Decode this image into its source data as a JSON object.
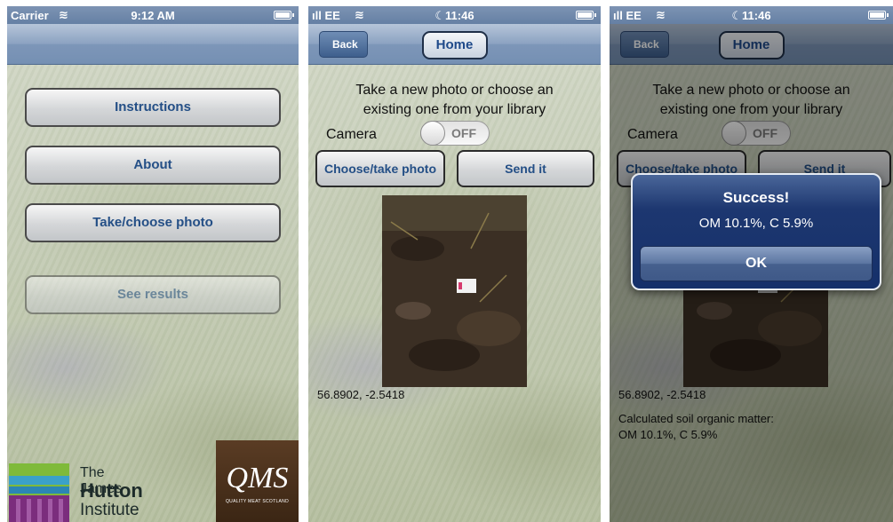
{
  "screen1": {
    "status": {
      "carrier": "Carrier",
      "time": "9:12 AM"
    },
    "menu": {
      "instructions": "Instructions",
      "about": "About",
      "take_choose_photo": "Take/choose photo",
      "see_results": "See results"
    },
    "logos": {
      "hutton_line1": "The James",
      "hutton_line2": "Hutton",
      "hutton_line3": "Institute",
      "qms": "QMS",
      "qms_sub": "QUALITY MEAT SCOTLAND"
    }
  },
  "screen2": {
    "status": {
      "carrier": "EE",
      "time": "11:46"
    },
    "nav": {
      "back": "Back",
      "home": "Home"
    },
    "prompt_line1": "Take a new photo or choose an",
    "prompt_line2": "existing one from your library",
    "camera_label": "Camera",
    "camera_toggle": "OFF",
    "choose_button": "Choose/take photo",
    "send_button": "Send it",
    "coords": "56.8902, -2.5418"
  },
  "screen3": {
    "status": {
      "carrier": "EE",
      "time": "11:46"
    },
    "nav": {
      "back": "Back",
      "home": "Home"
    },
    "prompt_line1": "Take a new photo or choose an",
    "prompt_line2": "existing one from your library",
    "camera_label": "Camera",
    "camera_toggle": "OFF",
    "choose_button": "Choose/take photo",
    "send_button": "Send it",
    "coords": "56.8902, -2.5418",
    "result_line1": "Calculated soil organic matter:",
    "result_line2": "OM 10.1%, C 5.9%",
    "alert": {
      "title": "Success!",
      "message": "OM 10.1%, C 5.9%",
      "ok": "OK"
    }
  },
  "colors": {
    "nav_blue": "#7d96b8",
    "button_text": "#244f86",
    "alert_blue": "#15306a"
  }
}
